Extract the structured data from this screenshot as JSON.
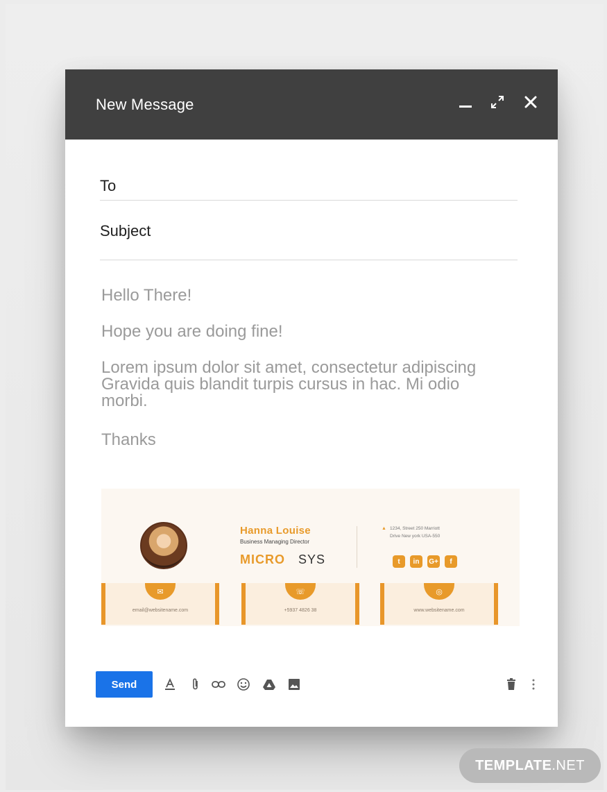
{
  "window": {
    "title": "New Message"
  },
  "fields": {
    "to_label": "To",
    "subject_label": "Subject"
  },
  "message": {
    "greeting": "Hello There!",
    "line2": "Hope you are doing fine!",
    "paragraph_line1": "Lorem ipsum dolor sit amet, consectetur adipiscing",
    "paragraph_line2": "Gravida quis blandit turpis cursus in hac. Mi odio",
    "paragraph_line3": "morbi.",
    "closing": "Thanks"
  },
  "signature": {
    "name": "Hanna Louise",
    "role": "Business Managing Director",
    "company_part1": "MICRO",
    "company_part2": "SYS",
    "address_line1": "1234, Street 250 Marriott",
    "address_line2": "Drive New york USA-550",
    "socials": [
      "t",
      "in",
      "G+",
      "f"
    ],
    "contacts": [
      {
        "icon": "envelope-icon",
        "glyph": "✉",
        "text": "email@websitename.com"
      },
      {
        "icon": "phone-icon",
        "glyph": "☏",
        "text": "+5937 4826 38"
      },
      {
        "icon": "globe-icon",
        "glyph": "◎",
        "text": "www.websitename.com"
      }
    ],
    "accent_color": "#e89a2a"
  },
  "toolbar": {
    "send_label": "Send"
  },
  "watermark": {
    "part1": "TEMPLATE",
    "part2": ".NET"
  },
  "colors": {
    "titlebar": "#404040",
    "send": "#1a73e8",
    "body_text": "#9a9a9a"
  }
}
